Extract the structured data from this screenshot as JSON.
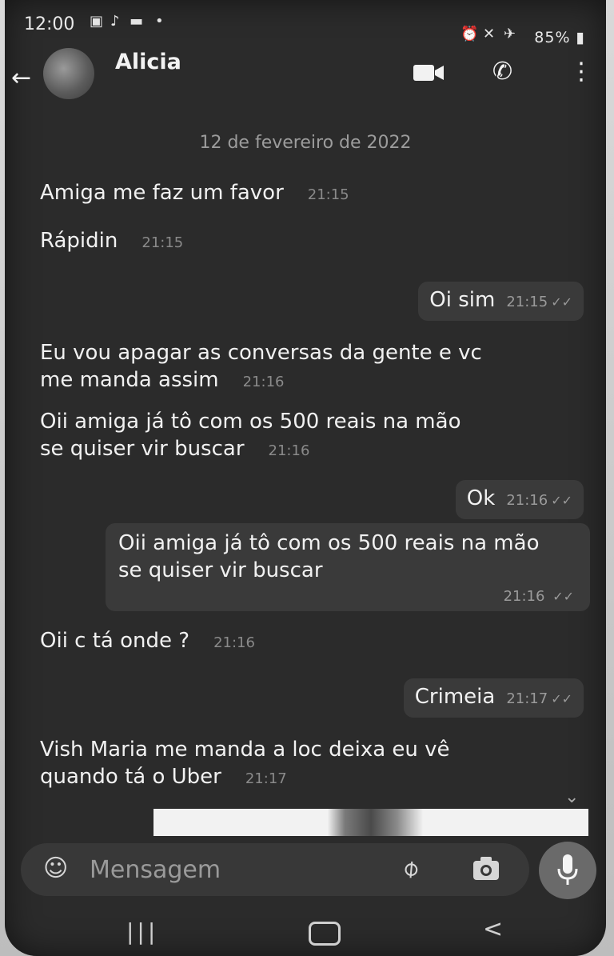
{
  "status_bar": {
    "time": "12:00",
    "battery": "85%"
  },
  "header": {
    "contact_name": "Alicia"
  },
  "chat": {
    "date_separator": "12 de fevereiro de 2022",
    "messages": [
      {
        "direction": "in",
        "text": "Amiga me faz um favor",
        "time": "21:15"
      },
      {
        "direction": "in",
        "text": "Rápidin",
        "time": "21:15"
      },
      {
        "direction": "out",
        "text": "Oi sim",
        "time": "21:15"
      },
      {
        "direction": "in",
        "text": "Eu vou apagar as conversas da gente e vc me manda assim",
        "time": "21:16"
      },
      {
        "direction": "in",
        "text": "Oii amiga já tô com os 500 reais na mão se quiser vir buscar",
        "time": "21:16"
      },
      {
        "direction": "out",
        "text": "Ok",
        "time": "21:16"
      },
      {
        "direction": "out",
        "text": "Oii amiga já tô com os 500 reais na mão se quiser vir buscar",
        "time": "21:16"
      },
      {
        "direction": "in",
        "text": "Oii c tá onde ?",
        "time": "21:16"
      },
      {
        "direction": "out",
        "text": "Crimeia",
        "time": "21:17"
      },
      {
        "direction": "in",
        "text": "Vish Maria me manda a loc deixa eu vê quando tá o Uber",
        "time": "21:17"
      }
    ]
  },
  "composer": {
    "placeholder": "Mensagem"
  },
  "icons": {
    "back": "arrow-left-icon",
    "video": "video-camera-icon",
    "call": "phone-icon",
    "menu": "more-vertical-icon",
    "emoji": "emoji-icon",
    "attach": "paperclip-icon",
    "camera": "camera-icon",
    "mic": "microphone-icon"
  }
}
